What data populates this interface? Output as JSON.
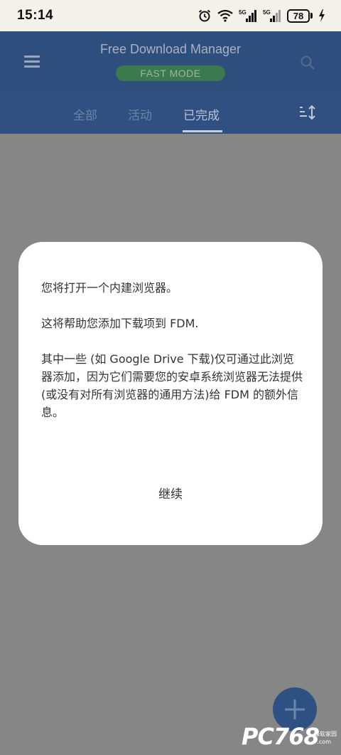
{
  "status_bar": {
    "time": "15:14",
    "signal_1": "5G",
    "signal_2": "5G",
    "battery": "78",
    "icons": [
      "alarm-icon",
      "wifi-icon",
      "signal-5g-icon",
      "signal-5g-icon",
      "battery-icon",
      "charging-icon"
    ]
  },
  "app_bar": {
    "title": "Free Download Manager",
    "badge": "FAST MODE",
    "icons": [
      "menu-icon",
      "search-icon"
    ]
  },
  "tabs": [
    {
      "label": "全部"
    },
    {
      "label": "活动"
    },
    {
      "label": "已完成",
      "active": true
    }
  ],
  "dialog": {
    "paragraph_1": "您将打开一个内建浏览器。",
    "paragraph_2": "这将帮助您添加下载项到 FDM.",
    "paragraph_3": "其中一些 (如 Google Drive 下载)仅可通过此浏览器添加，因为它们需要您的安卓系统浏览器无法提供 (或没有对所有浏览器的通用方法)给 FDM 的额外信息。",
    "continue_label": "继续"
  },
  "fab": {
    "icon": "plus-icon"
  },
  "watermark": {
    "text": "PC768",
    "sub": "绿软家园",
    "domain": ".com"
  },
  "colors": {
    "app_bar": "#2e4e7d",
    "tab_bar": "#2f5080",
    "overlay": "#868686",
    "fast_mode": "#3a7a4e",
    "fab": "#2d5182"
  }
}
